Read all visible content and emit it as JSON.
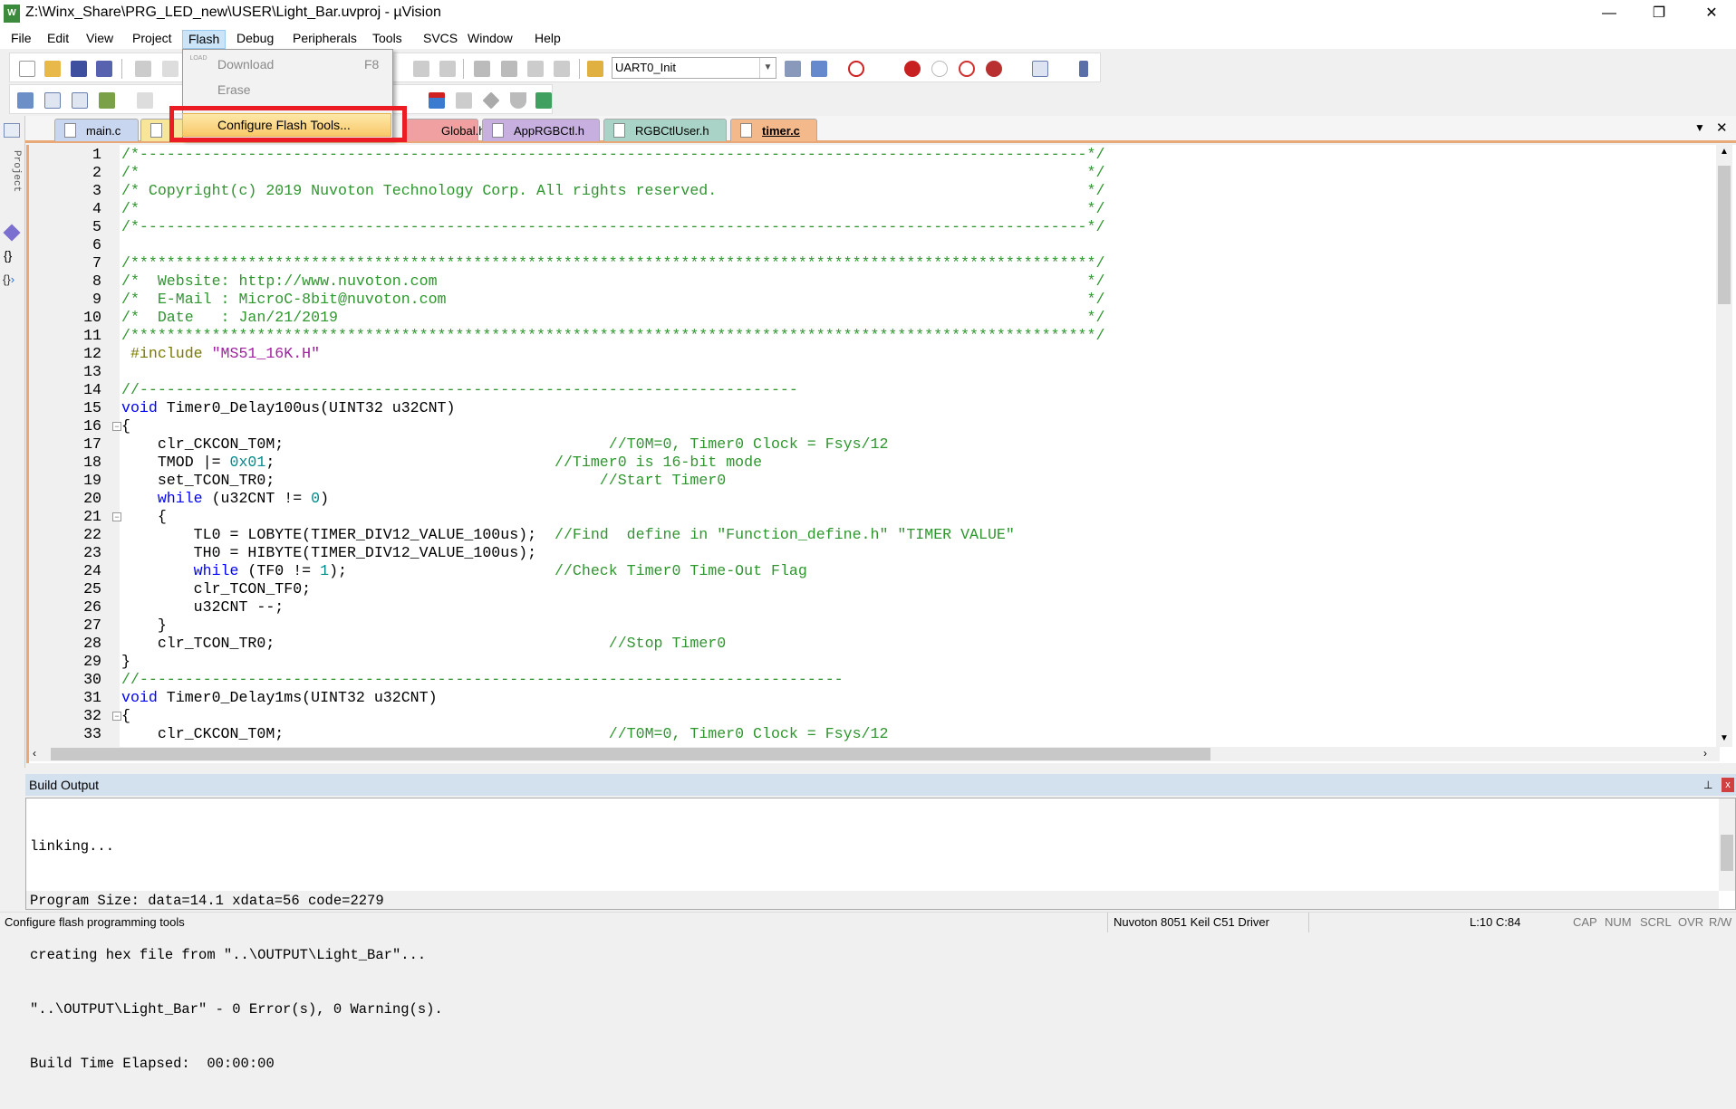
{
  "window": {
    "title": "Z:\\Winx_Share\\PRG_LED_new\\USER\\Light_Bar.uvproj - µVision",
    "app_icon": "W",
    "minimize": "—",
    "restore": "❐",
    "close": "✕"
  },
  "menu": [
    "File",
    "Edit",
    "View",
    "Project",
    "Flash",
    "Debug",
    "Peripherals",
    "Tools",
    "SVCS",
    "Window",
    "Help"
  ],
  "active_menu": "Flash",
  "flash_menu": {
    "items": [
      {
        "label": "Download",
        "shortcut": "F8",
        "icon": "load-icon",
        "icon_text": "LOAD",
        "enabled": false
      },
      {
        "label": "Erase",
        "enabled": false
      },
      {
        "label": "Configure Flash Tools...",
        "highlighted": true
      }
    ]
  },
  "toolbar": {
    "target_combo": "UART0_Init"
  },
  "tabs": [
    {
      "label": "main.c",
      "color": "#c9d6ef"
    },
    {
      "label": "",
      "color": "#f7e59a"
    },
    {
      "label": "Global.h",
      "color": "#f0a0a0"
    },
    {
      "label": "AppRGBCtl.h",
      "color": "#c7b0e0"
    },
    {
      "label": "RGBCtlUser.h",
      "color": "#a9d3c6"
    },
    {
      "label": "timer.c",
      "color": "#f4b98a",
      "active": true
    }
  ],
  "side_panel": {
    "project_label": "Project"
  },
  "code": [
    [
      [
        "cm",
        "/*---------------------------------------------------------------------------------------------------------*/"
      ]
    ],
    [
      [
        "cm",
        "/*                                                                                                         */"
      ]
    ],
    [
      [
        "cm",
        "/* Copyright(c) 2019 Nuvoton Technology Corp. All rights reserved.                                         */"
      ]
    ],
    [
      [
        "cm",
        "/*                                                                                                         */"
      ]
    ],
    [
      [
        "cm",
        "/*---------------------------------------------------------------------------------------------------------*/"
      ]
    ],
    [],
    [
      [
        "cm",
        "/***********************************************************************************************************/"
      ]
    ],
    [
      [
        "cm",
        "/*  Website: http://www.nuvoton.com                                                                        */"
      ]
    ],
    [
      [
        "cm",
        "/*  E-Mail : MicroC-8bit@nuvoton.com                                                                       */"
      ]
    ],
    [
      [
        "cm",
        "/*  Date   : Jan/21/2019                                                                                   */"
      ]
    ],
    [
      [
        "cm",
        "/***********************************************************************************************************/"
      ]
    ],
    [
      [
        "tx",
        " "
      ],
      [
        "pp",
        "#include "
      ],
      [
        "str",
        "\"MS51_16K.H\""
      ]
    ],
    [],
    [
      [
        "cm",
        "//-------------------------------------------------------------------------"
      ]
    ],
    [
      [
        "kw",
        "void"
      ],
      [
        "tx",
        " Timer0_Delay100us(UINT32 u32CNT)"
      ]
    ],
    [
      [
        "tx",
        "{"
      ]
    ],
    [
      [
        "tx",
        "    clr_CKCON_T0M;                                    "
      ],
      [
        "cm",
        "//T0M=0, Timer0 Clock = Fsys/12"
      ]
    ],
    [
      [
        "tx",
        "    TMOD |= "
      ],
      [
        "num",
        "0x01"
      ],
      [
        "tx",
        ";                               "
      ],
      [
        "cm",
        "//Timer0 is 16-bit mode"
      ]
    ],
    [
      [
        "tx",
        "    set_TCON_TR0;                                    "
      ],
      [
        "cm",
        "//Start Timer0"
      ]
    ],
    [
      [
        "tx",
        "    "
      ],
      [
        "kw",
        "while"
      ],
      [
        "tx",
        " (u32CNT != "
      ],
      [
        "num",
        "0"
      ],
      [
        "tx",
        ")"
      ]
    ],
    [
      [
        "tx",
        "    {"
      ]
    ],
    [
      [
        "tx",
        "        TL0 = LOBYTE(TIMER_DIV12_VALUE_100us);  "
      ],
      [
        "cm",
        "//Find  define in \"Function_define.h\" \"TIMER VALUE\""
      ]
    ],
    [
      [
        "tx",
        "        TH0 = HIBYTE(TIMER_DIV12_VALUE_100us);"
      ]
    ],
    [
      [
        "tx",
        "        "
      ],
      [
        "kw",
        "while"
      ],
      [
        "tx",
        " (TF0 != "
      ],
      [
        "num",
        "1"
      ],
      [
        "tx",
        ");                       "
      ],
      [
        "cm",
        "//Check Timer0 Time-Out Flag"
      ]
    ],
    [
      [
        "tx",
        "        clr_TCON_TF0;"
      ]
    ],
    [
      [
        "tx",
        "        u32CNT --;"
      ]
    ],
    [
      [
        "tx",
        "    }"
      ]
    ],
    [
      [
        "tx",
        "    clr_TCON_TR0;                                     "
      ],
      [
        "cm",
        "//Stop Timer0"
      ]
    ],
    [
      [
        "tx",
        "}"
      ]
    ],
    [
      [
        "cm",
        "//------------------------------------------------------------------------------"
      ]
    ],
    [
      [
        "kw",
        "void"
      ],
      [
        "tx",
        " Timer0_Delay1ms(UINT32 u32CNT)"
      ]
    ],
    [
      [
        "tx",
        "{"
      ]
    ],
    [
      [
        "tx",
        "    clr_CKCON_T0M;                                    "
      ],
      [
        "cm",
        "//T0M=0, Timer0 Clock = Fsys/12"
      ]
    ]
  ],
  "fold_open_lines": [
    16,
    21,
    32
  ],
  "build_output": {
    "title": "Build Output",
    "lines": [
      "linking...",
      "Program Size: data=14.1 xdata=56 code=2279",
      "creating hex file from \"..\\OUTPUT\\Light_Bar\"...",
      "\"..\\OUTPUT\\Light_Bar\" - 0 Error(s), 0 Warning(s).",
      "Build Time Elapsed:  00:00:00"
    ]
  },
  "status": {
    "message": "Configure flash programming tools",
    "driver": "Nuvoton 8051 Keil C51 Driver",
    "position": "L:10 C:84",
    "indicators": [
      "CAP",
      "NUM",
      "SCRL",
      "OVR",
      "R/W"
    ]
  },
  "colors": {
    "comment": "#2f962f",
    "keyword": "#0000ff",
    "number": "#008b8b",
    "string": "#a020a0",
    "highlight_box": "#ec1c24",
    "editor_border": "#e8a878"
  }
}
